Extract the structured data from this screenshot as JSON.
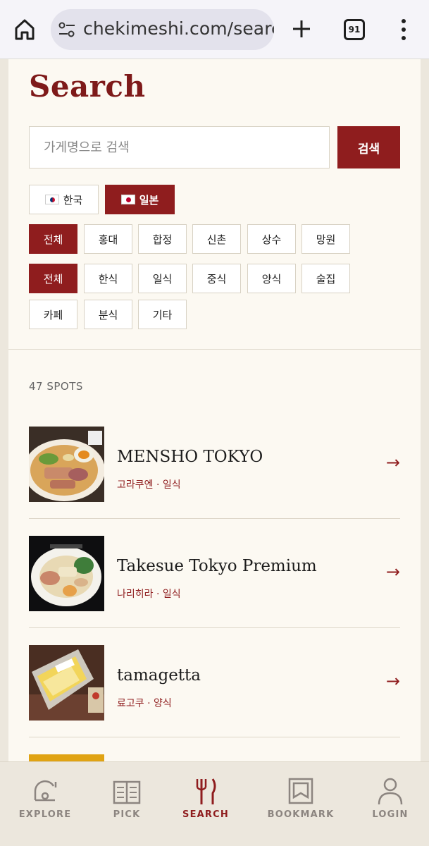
{
  "browser": {
    "url": "chekimeshi.com/search",
    "tab_count": "91"
  },
  "page": {
    "title": "Search",
    "search": {
      "placeholder": "가게명으로 검색",
      "button_label": "검색"
    },
    "country_filters": [
      {
        "label": "한국",
        "flag": "kr-flag-icon",
        "active": false
      },
      {
        "label": "일본",
        "flag": "jp-flag-icon",
        "active": true
      }
    ],
    "area_filters": [
      "전체",
      "홍대",
      "합정",
      "신촌",
      "상수",
      "망원"
    ],
    "category_filters": [
      "전체",
      "한식",
      "일식",
      "중식",
      "양식",
      "술집",
      "카페",
      "분식",
      "기타"
    ],
    "spots_count": "47 SPOTS",
    "results": [
      {
        "name": "MENSHO TOKYO",
        "meta": "고라쿠엔 · 일식",
        "arrow": "→"
      },
      {
        "name": "Takesue Tokyo Premium",
        "meta": "나리히라 · 일식",
        "arrow": "→"
      },
      {
        "name": "tamagetta",
        "meta": "료고쿠 · 양식",
        "arrow": "→"
      }
    ]
  },
  "bottom_nav": [
    {
      "label": "EXPLORE",
      "icon": "explore-icon",
      "active": false
    },
    {
      "label": "PICK",
      "icon": "book-icon",
      "active": false
    },
    {
      "label": "SEARCH",
      "icon": "fork-knife-icon",
      "active": true
    },
    {
      "label": "BOOKMARK",
      "icon": "bookmark-icon",
      "active": false
    },
    {
      "label": "LOGIN",
      "icon": "user-icon",
      "active": false
    }
  ],
  "colors": {
    "accent": "#8f1d1e",
    "title": "#7e1a1a",
    "page_bg": "#fcf9f2",
    "outer_bg": "#ece7dd"
  }
}
